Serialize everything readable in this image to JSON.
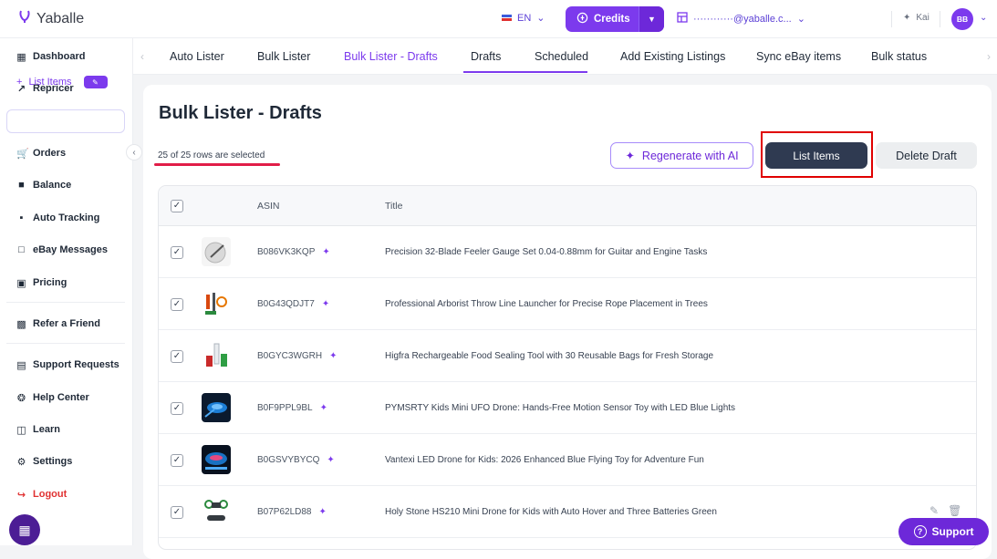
{
  "app": {
    "logo_text": "Yaballe"
  },
  "header": {
    "language": "EN",
    "credits_label": "Credits",
    "store_email": "············@yaballe.c...",
    "user_name": "Kai",
    "avatar_initials": "BB"
  },
  "sidebar": {
    "items": [
      {
        "label": "Dashboard",
        "icon": "dashboard-icon"
      },
      {
        "label": "Repricer",
        "icon": "trend-icon"
      },
      {
        "label": "List Items",
        "icon": "plus-icon"
      },
      {
        "label": "Orders",
        "icon": "cart-icon"
      },
      {
        "label": "Balance",
        "icon": "wallet-icon"
      },
      {
        "label": "Auto Tracking",
        "icon": "truck-icon"
      },
      {
        "label": "eBay Messages",
        "icon": "chat-icon"
      },
      {
        "label": "Pricing",
        "icon": "tag-icon"
      },
      {
        "label": "Refer a Friend",
        "icon": "gift-icon"
      },
      {
        "label": "Support Requests",
        "icon": "document-icon"
      },
      {
        "label": "Help Center",
        "icon": "help-icon"
      },
      {
        "label": "Learn",
        "icon": "book-icon"
      },
      {
        "label": "Settings",
        "icon": "gear-icon"
      },
      {
        "label": "Logout",
        "icon": "logout-icon"
      }
    ]
  },
  "tabs": [
    {
      "label": "Auto Lister"
    },
    {
      "label": "Bulk Lister"
    },
    {
      "label": "Bulk Lister - Drafts"
    },
    {
      "label": "Drafts"
    },
    {
      "label": "Scheduled"
    },
    {
      "label": "Add Existing Listings"
    },
    {
      "label": "Sync eBay items"
    },
    {
      "label": "Bulk status"
    }
  ],
  "main": {
    "title": "Bulk Lister - Drafts",
    "selection_text": "25 of 25 rows are selected",
    "regenerate_label": "Regenerate with AI",
    "list_items_label": "List Items",
    "delete_draft_label": "Delete Draft"
  },
  "table": {
    "columns": [
      "ASIN",
      "Title"
    ],
    "rows": [
      {
        "asin": "B086VK3KQP",
        "title": "Precision 32-Blade Feeler Gauge Set 0.04-0.88mm for Guitar and Engine Tasks"
      },
      {
        "asin": "B0G43QDJT7",
        "title": "Professional Arborist Throw Line Launcher for Precise Rope Placement in Trees"
      },
      {
        "asin": "B0GYC3WGRH",
        "title": "Higfra Rechargeable Food Sealing Tool with 30 Reusable Bags for Fresh Storage"
      },
      {
        "asin": "B0F9PPL9BL",
        "title": "PYMSRTY Kids Mini UFO Drone: Hands-Free Motion Sensor Toy with LED Blue Lights"
      },
      {
        "asin": "B0GSVYBYCQ",
        "title": "Vantexi LED Drone for Kids: 2026 Enhanced Blue Flying Toy for Adventure Fun"
      },
      {
        "asin": "B07P62LD88",
        "title": "Holy Stone HS210 Mini Drone for Kids with Auto Hover and Three Batteries Green"
      }
    ]
  },
  "support_label": "Support",
  "colors": {
    "accent": "#7c3aed",
    "primary_dark": "#2f3a51",
    "highlight": "#e00000"
  }
}
